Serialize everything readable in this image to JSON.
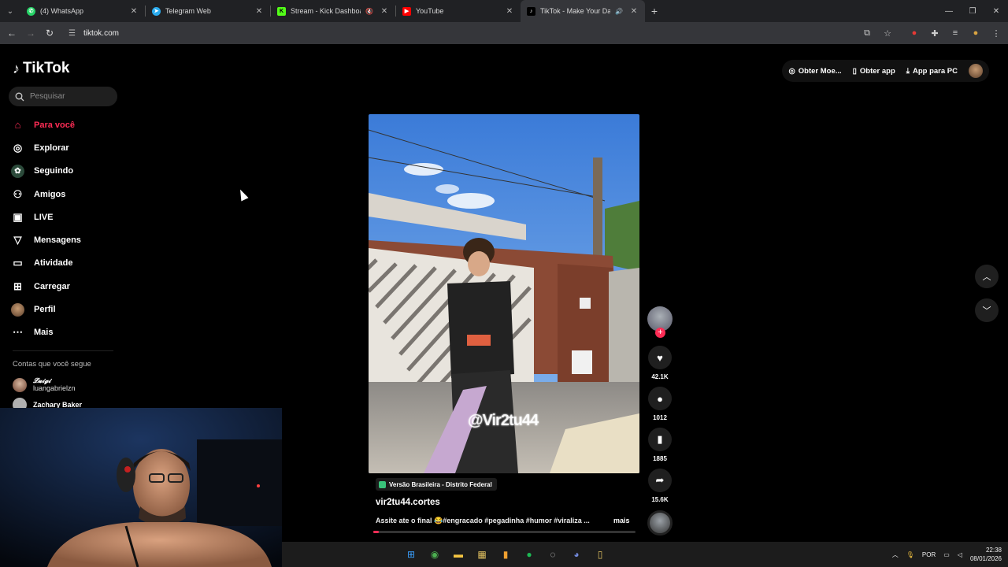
{
  "browser": {
    "tabs": [
      {
        "title": "(4) WhatsApp",
        "color": "#25d366",
        "icon": "whatsapp-icon"
      },
      {
        "title": "Telegram Web",
        "color": "#2aabee",
        "icon": "telegram-icon"
      },
      {
        "title": "Stream - Kick Dashboard",
        "color": "#53fc18",
        "icon": "kick-icon"
      },
      {
        "title": "YouTube",
        "color": "#ff0000",
        "icon": "youtube-icon"
      },
      {
        "title": "TikTok - Make Your Day",
        "color": "#000000",
        "icon": "tiktok-icon"
      }
    ],
    "url": "tiktok.com"
  },
  "tiktok": {
    "logo_text": "TikTok",
    "search_placeholder": "Pesquisar",
    "nav": [
      {
        "label": "Para você",
        "icon": "home-icon"
      },
      {
        "label": "Explorar",
        "icon": "compass-icon"
      },
      {
        "label": "Seguindo",
        "icon": "following-icon"
      },
      {
        "label": "Amigos",
        "icon": "friends-icon"
      },
      {
        "label": "LIVE",
        "icon": "live-icon"
      },
      {
        "label": "Mensagens",
        "icon": "messages-icon"
      },
      {
        "label": "Atividade",
        "icon": "activity-icon"
      },
      {
        "label": "Carregar",
        "icon": "upload-icon"
      },
      {
        "label": "Perfil",
        "icon": "profile-icon"
      },
      {
        "label": "Mais",
        "icon": "more-icon"
      }
    ],
    "following_header": "Contas que você segue",
    "accounts": [
      {
        "name": "𝓛𝓾𝓲𝓰𝓲",
        "username": "luangabrielzn"
      },
      {
        "name": "",
        "username": "Zachary Baker"
      }
    ],
    "top_buttons": {
      "coins": "Obter Moe...",
      "app": "Obter app",
      "pc": "App para PC"
    },
    "video": {
      "watermark": "@Vir2tu44",
      "location": "Versão Brasileira - Distrito Federal",
      "author": "vir2tu44.cortes",
      "caption": "Assite ate o final 😂#engracado #pegadinha #humor #viraliza ...",
      "more": "mais",
      "progress": 0.02
    },
    "actions": {
      "likes": "42.1K",
      "comments": "1012",
      "saves": "1885",
      "shares": "15.6K"
    }
  },
  "system": {
    "lang": "POR",
    "time": "22:38",
    "date": "08/01/2026"
  },
  "accent": "#fe2c55"
}
